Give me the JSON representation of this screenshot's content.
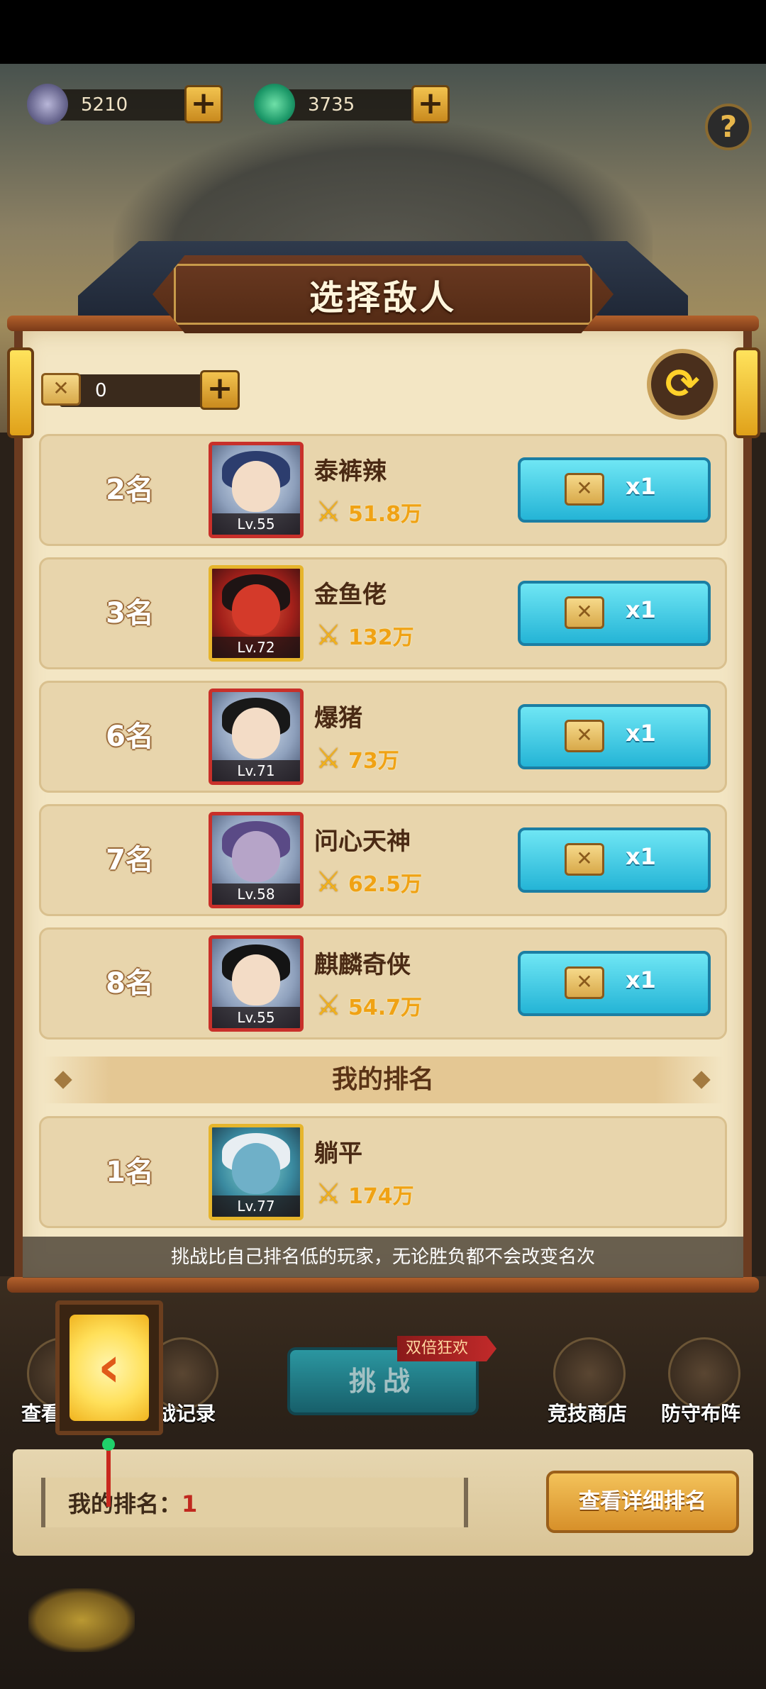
{
  "currency": {
    "gems": "5210",
    "jade": "3735"
  },
  "dialog": {
    "title": "选择敌人",
    "tickets": "0",
    "refresh_icon": "refresh-icon"
  },
  "enemies": [
    {
      "rank": "2名",
      "name": "泰裤辣",
      "level": "Lv.55",
      "power": "51.8万",
      "cost": "x1"
    },
    {
      "rank": "3名",
      "name": "金鱼佬",
      "level": "Lv.72",
      "power": "132万",
      "cost": "x1"
    },
    {
      "rank": "6名",
      "name": "爆猪",
      "level": "Lv.71",
      "power": "73万",
      "cost": "x1"
    },
    {
      "rank": "7名",
      "name": "问心天神",
      "level": "Lv.58",
      "power": "62.5万",
      "cost": "x1"
    },
    {
      "rank": "8名",
      "name": "麒麟奇侠",
      "level": "Lv.55",
      "power": "54.7万",
      "cost": "x1"
    }
  ],
  "my_rank": {
    "header": "我的排名",
    "rank": "1名",
    "name": "躺平",
    "level": "Lv.77",
    "power": "174万"
  },
  "notice": "挑战比自己排名低的玩家，无论胜负都不会改变名次",
  "bottom": {
    "view_label": "查看",
    "record_label": "战记录",
    "challenge": "挑战",
    "double_tag": "双倍狂欢",
    "shop_label": "竞技商店",
    "defense_label": "防守布阵",
    "my_rank_label": "我的排名：",
    "my_rank_value": "1",
    "detail_button": "查看详细排名"
  }
}
